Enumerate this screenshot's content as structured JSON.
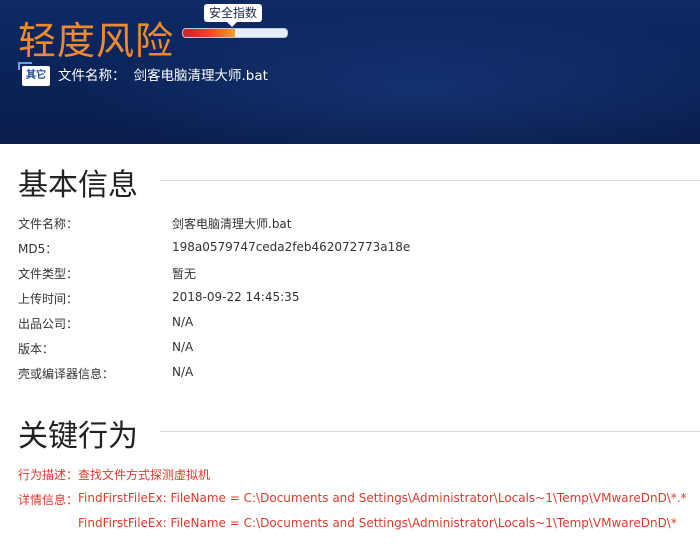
{
  "header": {
    "risk_level": "轻度风险",
    "safety_index_label": "安全指数",
    "safety_index_fraction": 0.5,
    "file_icon_text": "其它",
    "file_name_label": "文件名称：",
    "file_name_value": "剑客电脑清理大师.bat"
  },
  "basic_info": {
    "title": "基本信息",
    "rows": [
      {
        "label": "文件名称：",
        "value": "剑客电脑清理大师.bat"
      },
      {
        "label": "MD5：",
        "value": "198a0579747ceda2feb462072773a18e"
      },
      {
        "label": "文件类型：",
        "value": "暂无"
      },
      {
        "label": "上传时间：",
        "value": "2018-09-22 14:45:35"
      },
      {
        "label": "出品公司：",
        "value": "N/A"
      },
      {
        "label": "版本：",
        "value": "N/A"
      },
      {
        "label": "壳或编译器信息：",
        "value": "N/A"
      }
    ]
  },
  "key_behavior": {
    "title": "关键行为",
    "description_label": "行为描述：",
    "description_value": "查找文件方式探测虚拟机",
    "detail_label": "详情信息：",
    "details": [
      "FindFirstFileEx: FileName = C:\\Documents and Settings\\Administrator\\Locals~1\\Temp\\VMwareDnD\\*.*",
      "FindFirstFileEx: FileName = C:\\Documents and Settings\\Administrator\\Locals~1\\Temp\\VMwareDnD\\*"
    ]
  },
  "colors": {
    "header_bg": "#0a2257",
    "risk_orange": "#f08a2e",
    "behavior_red": "#e0392b"
  }
}
